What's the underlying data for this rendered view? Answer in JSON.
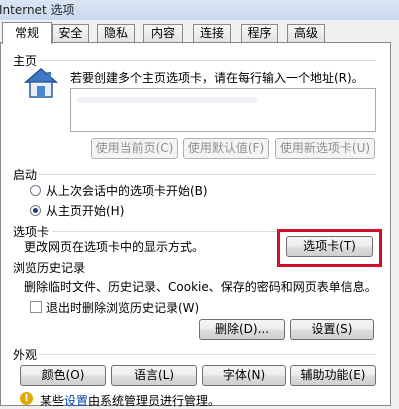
{
  "window": {
    "title": "Internet 选项"
  },
  "tabs": [
    {
      "label": "常规"
    },
    {
      "label": "安全"
    },
    {
      "label": "隐私"
    },
    {
      "label": "内容"
    },
    {
      "label": "连接"
    },
    {
      "label": "程序"
    },
    {
      "label": "高级"
    }
  ],
  "active_tab": "常规",
  "homepage": {
    "section_title": "主页",
    "description": "若要创建多个主页选项卡，请在每行输入一个地址(R)。",
    "btn_current": "使用当前页(C)",
    "btn_default": "使用默认值(F)",
    "btn_blank": "使用新选项卡(U)"
  },
  "startup": {
    "section_title": "启动",
    "option_last_session": "从上次会话中的选项卡开始(B)",
    "option_homepage": "从主页开始(H)",
    "selected": "option_homepage"
  },
  "tabs_section": {
    "section_title": "选项卡",
    "description": "更改网页在选项卡中的显示方式。",
    "button": "选项卡(T)"
  },
  "history": {
    "section_title": "浏览历史记录",
    "description": "删除临时文件、历史记录、Cookie、保存的密码和网页表单信息。",
    "checkbox_label": "退出时删除浏览历史记录(W)",
    "checkbox_checked": false,
    "btn_delete": "删除(D)...",
    "btn_settings": "设置(S)"
  },
  "appearance": {
    "section_title": "外观",
    "btn_colors": "颜色(O)",
    "btn_languages": "语言(L)",
    "btn_fonts": "字体(N)",
    "btn_accessibility": "辅助功能(E)"
  },
  "footer": {
    "prefix": "某些",
    "link": "设置",
    "suffix": "由系统管理员进行管理。"
  },
  "colors": {
    "highlight_border": "#d0112b",
    "panel_border": "#8a8a8a"
  }
}
